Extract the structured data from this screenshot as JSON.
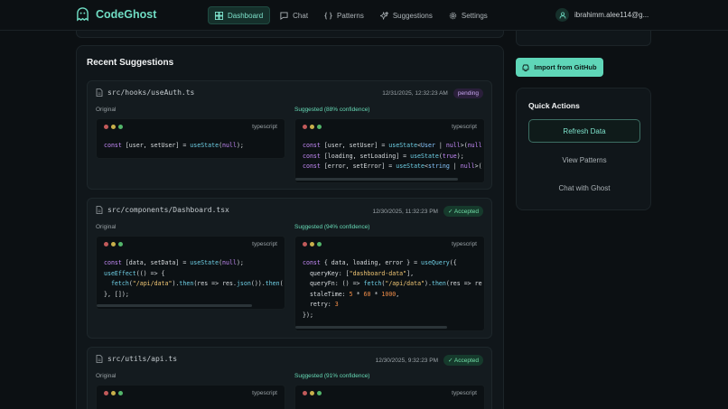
{
  "brand": {
    "name": "CodeGhost"
  },
  "nav": {
    "items": [
      {
        "label": "Dashboard",
        "icon": "dashboard-icon",
        "active": true
      },
      {
        "label": "Chat",
        "icon": "chat-icon"
      },
      {
        "label": "Patterns",
        "icon": "braces-icon"
      },
      {
        "label": "Suggestions",
        "icon": "sparkles-icon"
      },
      {
        "label": "Settings",
        "icon": "gear-icon"
      }
    ],
    "user": "ibrahimm.alee114@g..."
  },
  "main": {
    "title": "Recent Suggestions",
    "original_label": "Original",
    "language": "typescript",
    "suggestions": [
      {
        "file": "src/hooks/useAuth.ts",
        "timestamp": "12/31/2025, 12:32:23 AM",
        "status": "pending",
        "confidence_label": "Suggested (88% confidence)",
        "original": [
          "const [user, setUser] = useState(null);"
        ],
        "suggested": [
          "const [user, setUser] = useState<User | null>(null",
          "const [loading, setLoading] = useState(true);",
          "const [error, setError] = useState<string | null>("
        ]
      },
      {
        "file": "src/components/Dashboard.tsx",
        "timestamp": "12/30/2025, 11:32:23 PM",
        "status": "Accepted",
        "confidence_label": "Suggested (94% confidence)",
        "original": [
          "const [data, setData] = useState(null);",
          "useEffect(() => {",
          "  fetch(\"/api/data\").then(res => res.json()).then(",
          "}, []);"
        ],
        "suggested": [
          "const { data, loading, error } = useQuery({",
          "  queryKey: [\"dashboard-data\"],",
          "  queryFn: () => fetch(\"/api/data\").then(res => re",
          "  staleTime: 5 * 60 * 1000,",
          "  retry: 3",
          "});"
        ]
      },
      {
        "file": "src/utils/api.ts",
        "timestamp": "12/30/2025, 9:32:23 PM",
        "status": "Accepted",
        "confidence_label": "Suggested (91% confidence)"
      }
    ]
  },
  "sidebar": {
    "import_button": "Import from GitHub",
    "quick_actions": {
      "title": "Quick Actions",
      "buttons": [
        "Refresh Data",
        "View Patterns",
        "Chat with Ghost"
      ]
    }
  },
  "colors": {
    "accent": "#5fd6b8",
    "background": "#0c1013",
    "card": "#10161a"
  }
}
